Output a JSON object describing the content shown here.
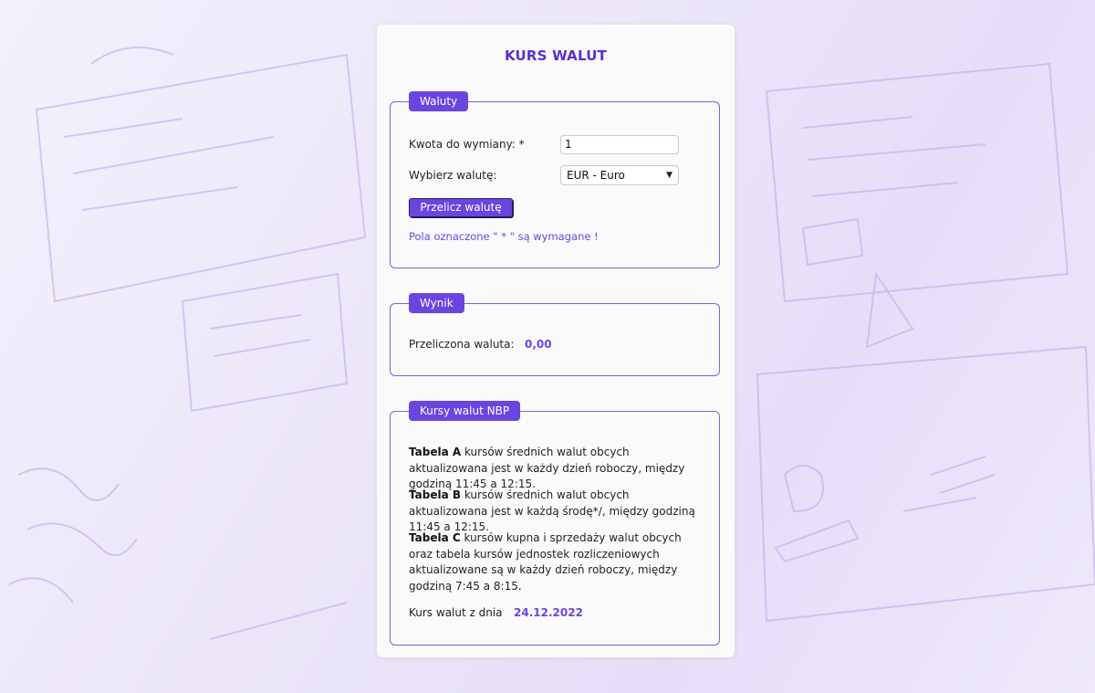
{
  "title": "KURS WALUT",
  "waluty": {
    "legend": "Waluty",
    "amount_label": "Kwota do wymiany: *",
    "amount_value": "1",
    "currency_label": "Wybierz walutę:",
    "currency_selected": "EUR - Euro",
    "button_label": "Przelicz walutę",
    "required_note": "Pola oznaczone \" * \" są wymagane !"
  },
  "wynik": {
    "legend": "Wynik",
    "label": "Przeliczona waluta:",
    "value": "0,00"
  },
  "nbp": {
    "legend": "Kursy walut NBP",
    "table_a_name": "Tabela A",
    "table_a_text": " kursów średnich walut obcych aktualizowana jest w każdy dzień roboczy, między godziną 11:45 a 12:15.",
    "table_b_name": "Tabela B",
    "table_b_text": " kursów średnich walut obcych aktualizowana jest w każdą środę*/, między godziną 11:45 a 12:15.",
    "table_c_name": "Tabela C",
    "table_c_text": " kursów kupna i sprzedaży walut obcych oraz tabela kursów jednostek rozliczeniowych aktualizowane są w każdy dzień roboczy, między godziną 7:45 a 8:15.",
    "date_label": "Kurs walut z dnia",
    "date_value": "24.12.2022"
  }
}
